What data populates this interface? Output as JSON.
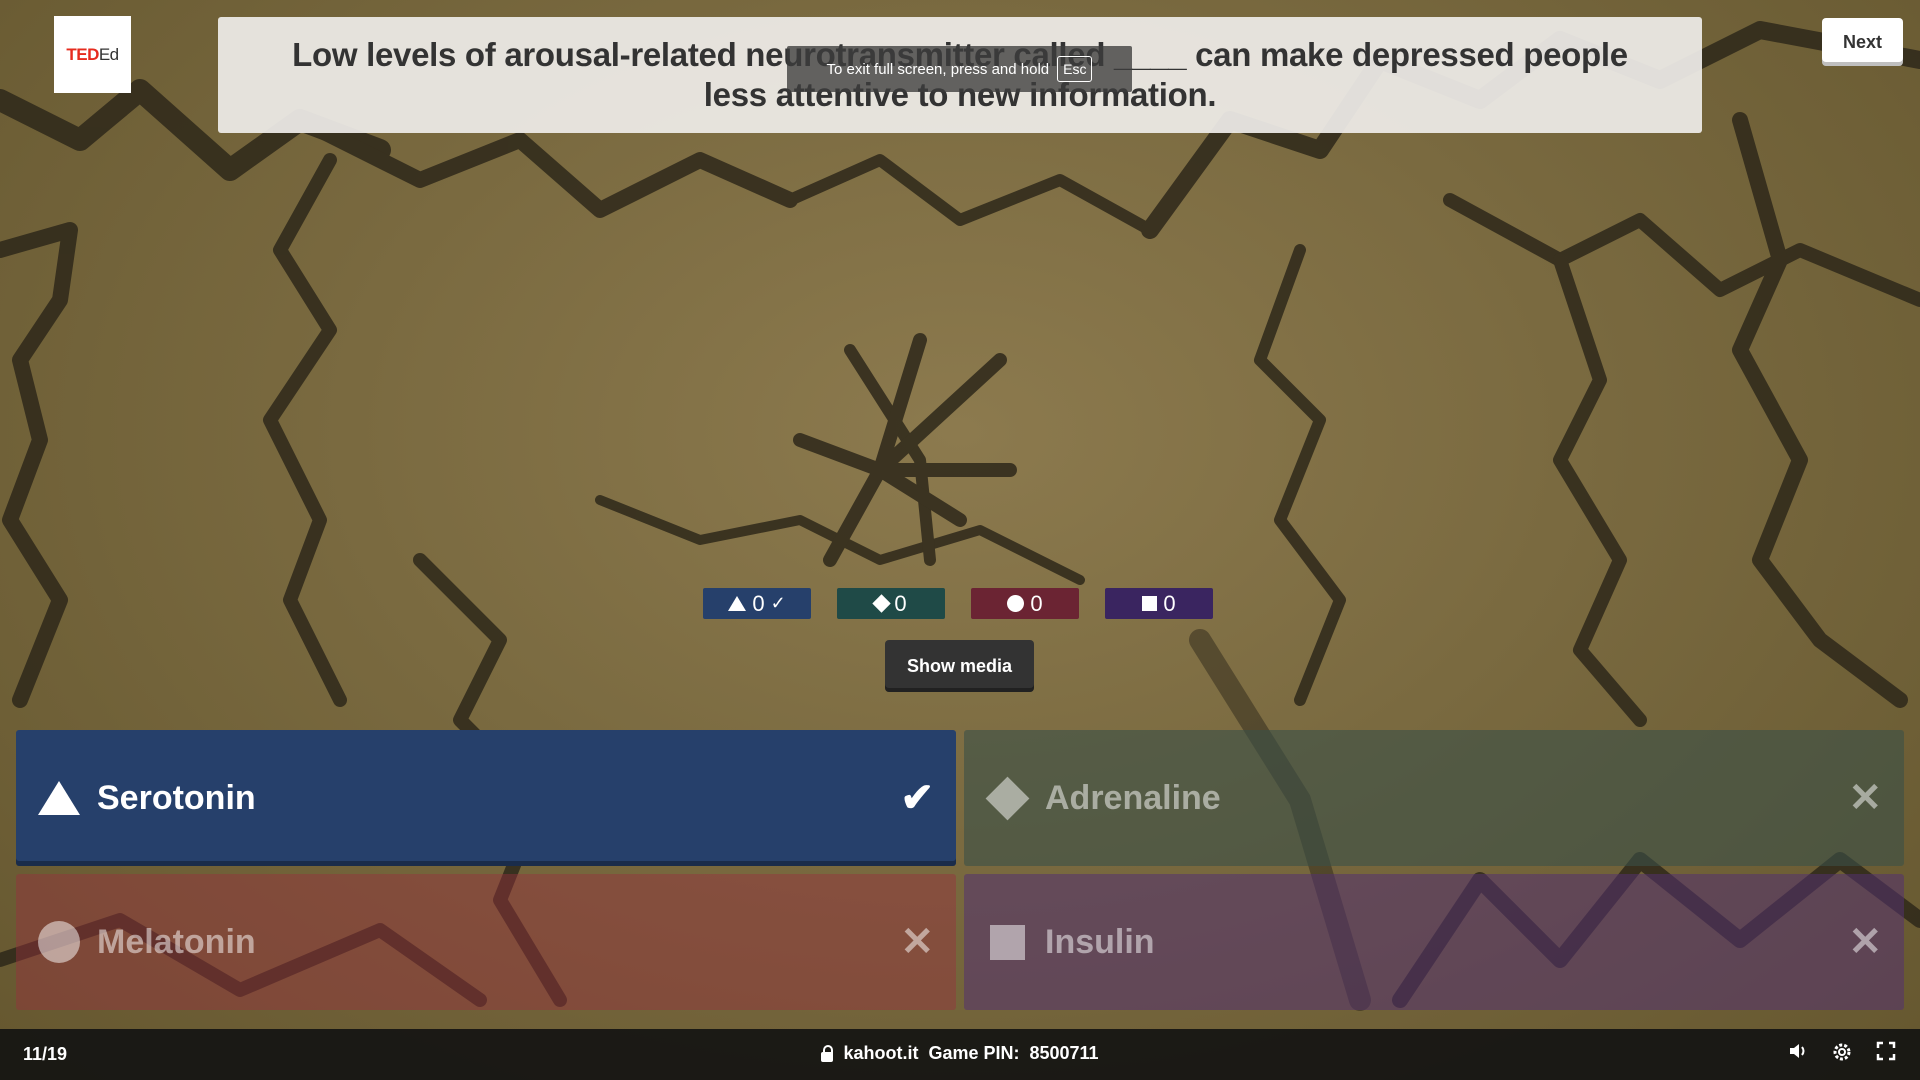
{
  "logo": {
    "ted": "TED",
    "ed": "Ed"
  },
  "question": "Low levels of arousal-related neurotransmitter called ____ can make depressed people less attentive to new information.",
  "fullscreen_toast": {
    "text": "To exit full screen, press and hold",
    "key": "Esc"
  },
  "next_label": "Next",
  "counters": [
    {
      "shape": "triangle-icon",
      "count": "0",
      "check": "✓",
      "color": "#26406b"
    },
    {
      "shape": "diamond-icon",
      "count": "0",
      "check": "",
      "color": "#1f4a47"
    },
    {
      "shape": "circle-icon",
      "count": "0",
      "check": "",
      "color": "#6b2433"
    },
    {
      "shape": "square-icon",
      "count": "0",
      "check": "",
      "color": "#3a2560"
    }
  ],
  "show_media_label": "Show media",
  "answers": [
    {
      "label": "Serotonin",
      "shape": "triangle-icon",
      "mark": "✔",
      "correct": true
    },
    {
      "label": "Adrenaline",
      "shape": "diamond-icon",
      "mark": "✕",
      "correct": false
    },
    {
      "label": "Melatonin",
      "shape": "circle-icon",
      "mark": "✕",
      "correct": false
    },
    {
      "label": "Insulin",
      "shape": "square-icon",
      "mark": "✕",
      "correct": false
    }
  ],
  "footer": {
    "progress": "11/19",
    "site": "kahoot.it",
    "pin_label": "Game PIN:",
    "pin": "8500711",
    "icons": [
      "speaker-icon",
      "gear-icon",
      "fullscreen-icon"
    ]
  }
}
